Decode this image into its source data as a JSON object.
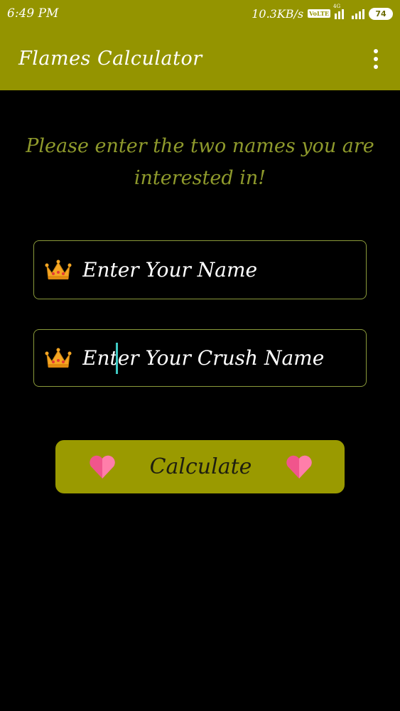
{
  "status_bar": {
    "time": "6:49 PM",
    "net_speed": "10.3KB/s",
    "volte": "VoLTE",
    "network_type": "4G",
    "battery": "74"
  },
  "app_bar": {
    "title": "Flames Calculator",
    "menu_icon": "more-vert-icon"
  },
  "main": {
    "prompt": "Please enter the two names you are interested in!",
    "name_field": {
      "placeholder": "Enter Your Name",
      "value": "",
      "icon": "crown-icon"
    },
    "crush_field": {
      "placeholder": "Enter Your Crush Name",
      "value": "",
      "icon": "crown-icon"
    },
    "calculate_button": {
      "label": "Calculate",
      "icon": "heart-icon"
    }
  },
  "colors": {
    "accent": "#949400",
    "background": "#000000",
    "prompt_text": "#8f9a2c",
    "field_border": "#8a9a3a",
    "cursor": "#3fc9c3",
    "heart": "#f0558c"
  }
}
